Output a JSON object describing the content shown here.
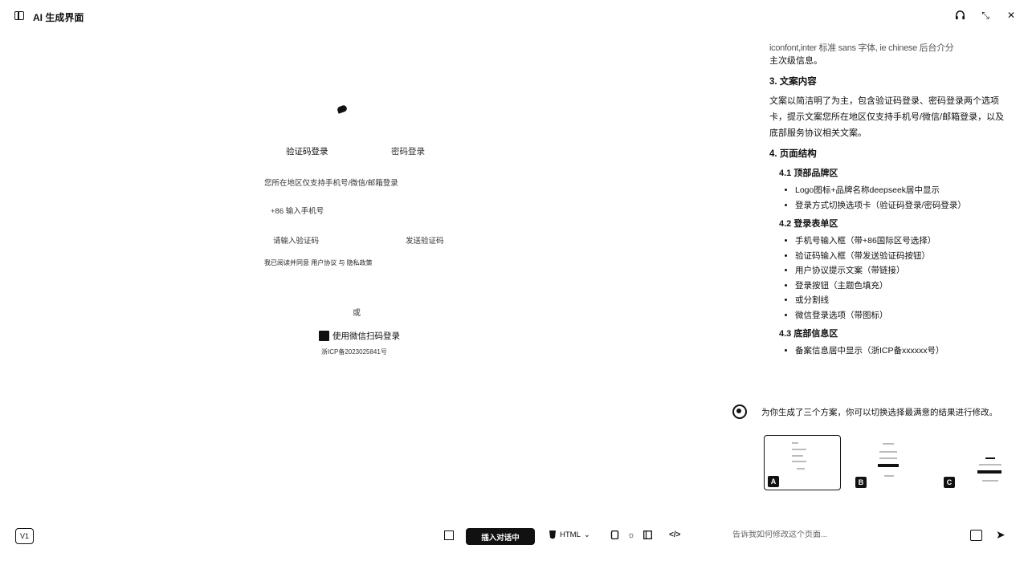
{
  "titlebar": {
    "title": "AI 生成界面",
    "headset_icon": "headset-icon",
    "minimize_glyph": "⤡",
    "close_glyph": "✕"
  },
  "preview": {
    "tabs": [
      "验证码登录",
      "密码登录"
    ],
    "hint": "您所在地区仅支持手机号/微信/邮箱登录",
    "phone_placeholder": "+86 输入手机号",
    "code_placeholder": "请输入验证码",
    "send_code": "发送验证码",
    "agreement": "我已阅读并同意 用户协议 与 隐私政策",
    "divider": "或",
    "wechat_login": "使用微信扫码登录",
    "icp": "浙ICP备2023025841号"
  },
  "doc": {
    "cut_line": "iconfont,inter 标准 sans 字体, ie chinese 后台介分",
    "cut_line_2": "主次级信息。",
    "s3_title": "3. 文案内容",
    "s3_body": "文案以简洁明了为主，包含验证码登录、密码登录两个选项卡，提示文案您所在地区仅支持手机号/微信/邮箱登录，以及底部服务协议相关文案。",
    "s4_title": "4. 页面结构",
    "s41_title": "4.1 顶部品牌区",
    "s41_items": [
      "Logo图标+品牌名称deepseek居中显示",
      "登录方式切换选项卡（验证码登录/密码登录）"
    ],
    "s42_title": "4.2 登录表单区",
    "s42_items": [
      "手机号输入框（带+86国际区号选择）",
      "验证码输入框（带发送验证码按钮）",
      "用户协议提示文案（带链接）",
      "登录按钮（主题色填充）",
      "或分割线",
      "微信登录选项（带图标）"
    ],
    "s43_title": "4.3 底部信息区",
    "s43_items": [
      "备案信息居中显示（浙ICP备xxxxxx号）"
    ]
  },
  "reply": {
    "text": "为你生成了三个方案，你可以切换选择最满意的结果进行修改。"
  },
  "thumbnails": [
    {
      "label": "A",
      "selected": true
    },
    {
      "label": "B",
      "selected": false
    },
    {
      "label": "C",
      "selected": false
    }
  ],
  "bottombar": {
    "version": "V1",
    "insert_button": "插入对话中",
    "format": "HTML",
    "code_glyph": "</>",
    "input_placeholder": "告诉我如何修改这个页面...",
    "send_glyph": "➤"
  }
}
